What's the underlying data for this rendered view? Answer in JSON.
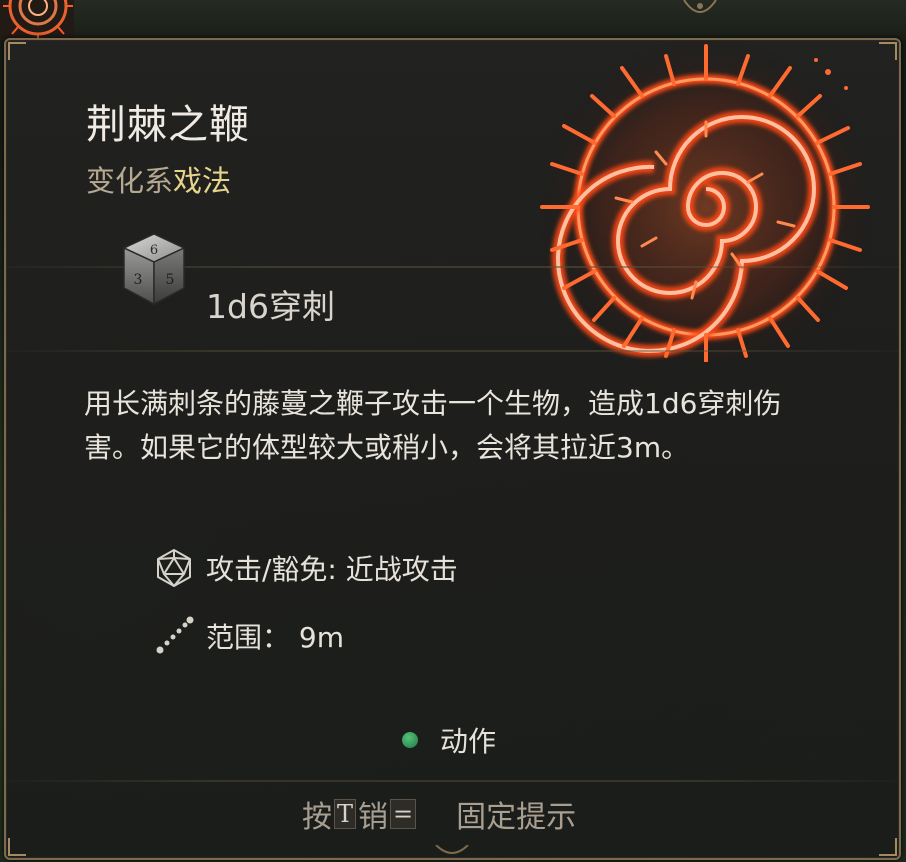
{
  "spell": {
    "name": "荆棘之鞭",
    "school": "变化系",
    "level": "戏法",
    "damage": "1d6穿刺",
    "description": "用长满刺条的藤蔓之鞭子攻击一个生物，造成1d6穿刺伤害。如果它的体型较大或稍小，会将其拉近3m。",
    "attack_label": "攻击/豁免: 近战攻击",
    "range_label": "范围：  9m",
    "cost_label": "动作"
  },
  "footer": {
    "press": "按",
    "key_t": "T",
    "cancel": "销",
    "key_eq": "=",
    "pin_hint": "固定提示"
  },
  "icons": {
    "spell_art": "thorn-whip-spiral-icon",
    "damage_die": "d6-die-icon",
    "attack": "d20-icon",
    "range": "range-dots-icon",
    "action": "action-dot-icon"
  },
  "colors": {
    "panel_border": "#7c6a4e",
    "title": "#efebe4",
    "school": "#b7a991",
    "level": "#e7d48c",
    "spell_glow": "#ff5a28",
    "action_dot": "#3aa866"
  }
}
